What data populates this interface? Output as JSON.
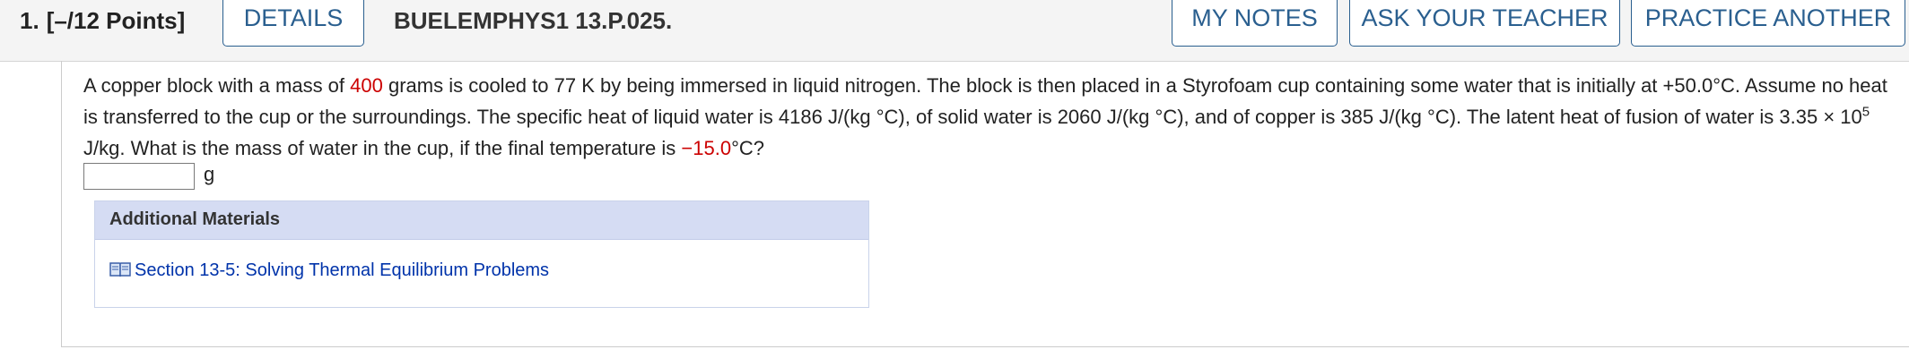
{
  "header": {
    "question_number": "1.",
    "points": "[–/12 Points]",
    "details_label": "DETAILS",
    "question_id": "BUELEMPHYS1 13.P.025.",
    "my_notes_label": "MY NOTES",
    "ask_teacher_label": "ASK YOUR TEACHER",
    "practice_another_label": "PRACTICE ANOTHER"
  },
  "question": {
    "t1": "A copper block with a mass of ",
    "mass": "400",
    "t2": " grams is cooled to 77 K by being immersed in liquid nitrogen. The block is then placed in a Styrofoam cup containing some water that is initially at +50.0°C. Assume no heat is transferred to the cup or the surroundings. The specific heat of liquid water is 4186 J/(kg °C), of solid water is 2060 J/(kg °C), and of copper is 385 J/(kg °C). The latent heat of fusion of water is 3.35 × 10",
    "exponent": "5",
    "t3": " J/kg. What is the mass of water in the cup, if the final temperature is ",
    "final_temp": "−15.0",
    "t4": "°C?"
  },
  "answer": {
    "value": "",
    "unit": "g"
  },
  "additional_materials": {
    "title": "Additional Materials",
    "link_label": "Section 13-5: Solving Thermal Equilibrium Problems",
    "icon": "book-icon"
  },
  "colors": {
    "accent": "#2a5f8f",
    "highlight": "#cc0000",
    "link": "#0033aa",
    "panel_header": "#d5dcf3"
  }
}
